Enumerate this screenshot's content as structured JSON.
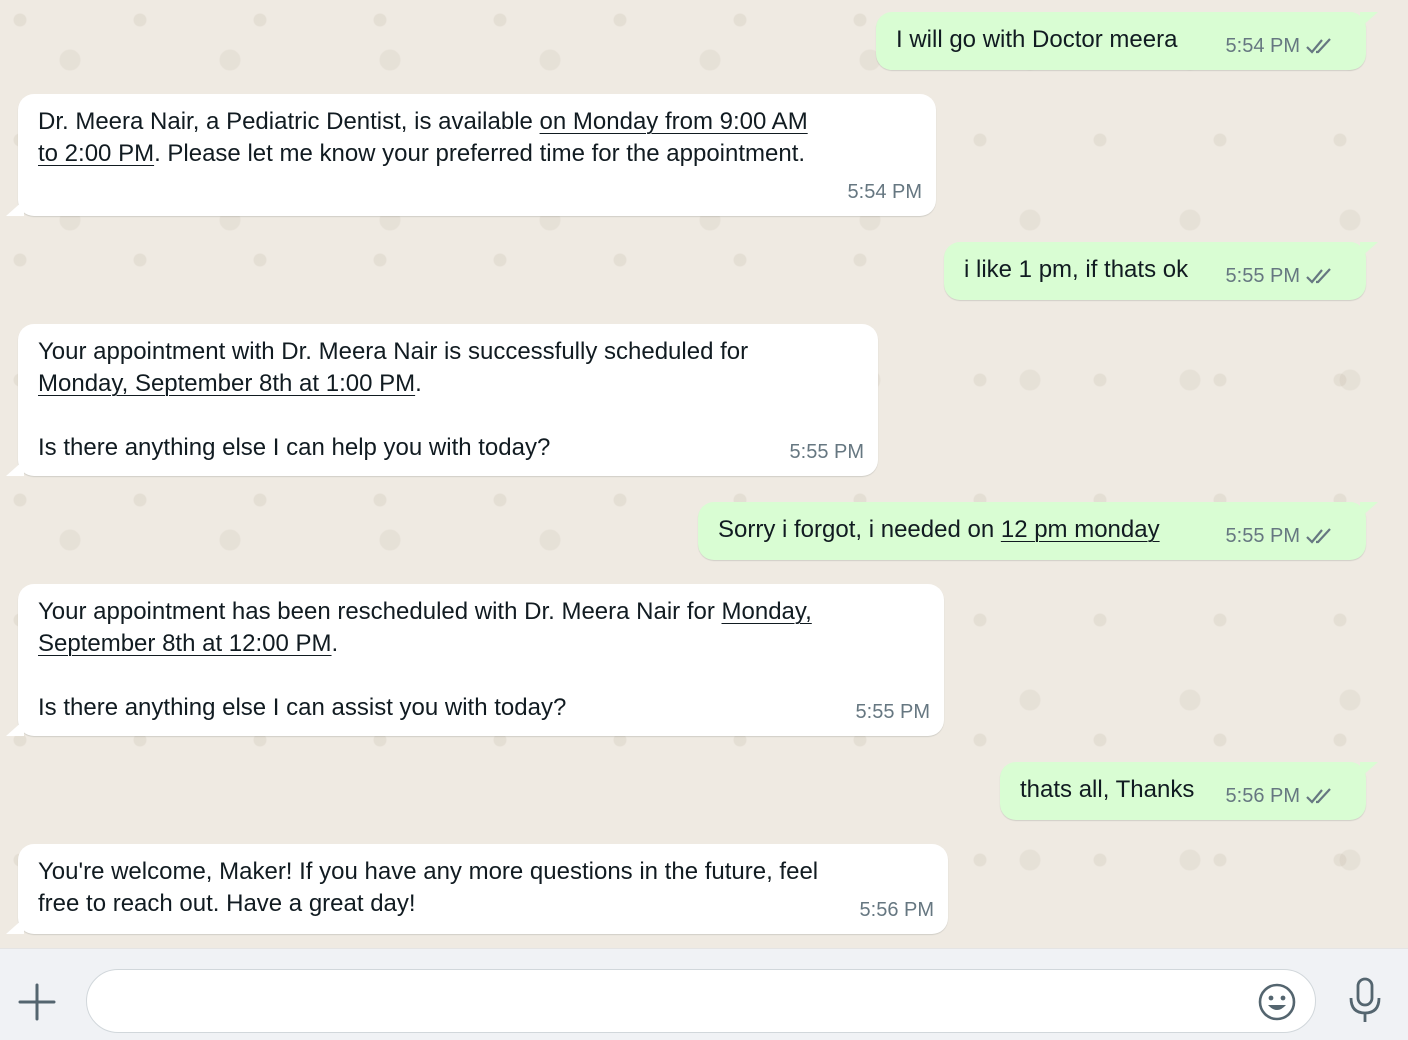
{
  "messages": [
    {
      "dir": "out",
      "text": "I will go with Doctor meera",
      "time": "5:54 PM"
    },
    {
      "dir": "in",
      "line1a": "Dr. Meera Nair, a Pediatric Dentist, is available ",
      "line1b": "on Monday from 9:00 AM",
      "line2a": "to 2:00 PM",
      "line2b": ". Please let me know your preferred time for the appointment.",
      "time": "5:54 PM"
    },
    {
      "dir": "out",
      "text": "i like 1 pm, if thats ok",
      "time": "5:55 PM"
    },
    {
      "dir": "in",
      "line1": "Your appointment with Dr. Meera Nair is successfully scheduled for",
      "line2a": "Monday, September 8th at 1:00 PM",
      "line2b": ".",
      "line3": "Is there anything else I can help you with today?",
      "time": "5:55 PM"
    },
    {
      "dir": "out",
      "texta": "Sorry i forgot, i needed on ",
      "textb": "12 pm monday",
      "time": "5:55 PM"
    },
    {
      "dir": "in",
      "line1a": "Your appointment has been rescheduled with Dr. Meera Nair for ",
      "line1b": "Monday,",
      "line2a": "September 8th at 12:00 PM",
      "line2b": ".",
      "line3": "Is there anything else I can assist you with today?",
      "time": "5:55 PM"
    },
    {
      "dir": "out",
      "text": "thats all, Thanks",
      "time": "5:56 PM"
    },
    {
      "dir": "in",
      "line1": "You're welcome, Maker! If you have any more questions in the future, feel",
      "line2": "free to reach out. Have a great day!",
      "time": "5:56 PM"
    }
  ],
  "composer": {
    "placeholder": "",
    "value": "",
    "icons": [
      "plus-icon",
      "emoji-icon",
      "microphone-icon"
    ]
  },
  "colors": {
    "outgoing_bubble": "#d9fdd3",
    "incoming_bubble": "#ffffff",
    "chat_background": "#efeae2",
    "timestamp": "#667781"
  }
}
